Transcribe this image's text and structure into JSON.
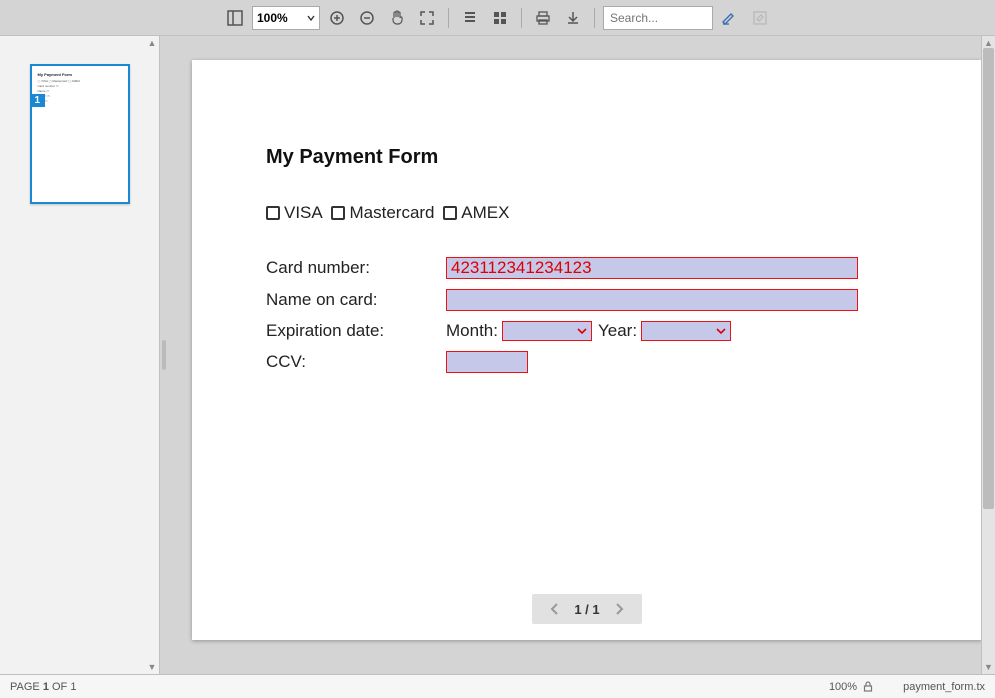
{
  "toolbar": {
    "zoom_level": "100%",
    "search_placeholder": "Search..."
  },
  "thumbnail": {
    "page_badge": "1"
  },
  "page": {
    "title": "My Payment Form",
    "checkboxes": {
      "visa": "VISA",
      "mastercard": "Mastercard",
      "amex": "AMEX"
    },
    "labels": {
      "card_number": "Card number:",
      "name_on_card": "Name on card:",
      "expiration": "Expiration date:",
      "ccv": "CCV:",
      "month": "Month:",
      "year": "Year:"
    },
    "values": {
      "card_number": "423112341234123",
      "name_on_card": "",
      "ccv": ""
    }
  },
  "pager": {
    "display": "1 / 1"
  },
  "status": {
    "page_prefix": "PAGE ",
    "page_current": "1",
    "page_mid": " OF ",
    "page_total": "1",
    "zoom": "100%",
    "filename": "payment_form.tx"
  }
}
